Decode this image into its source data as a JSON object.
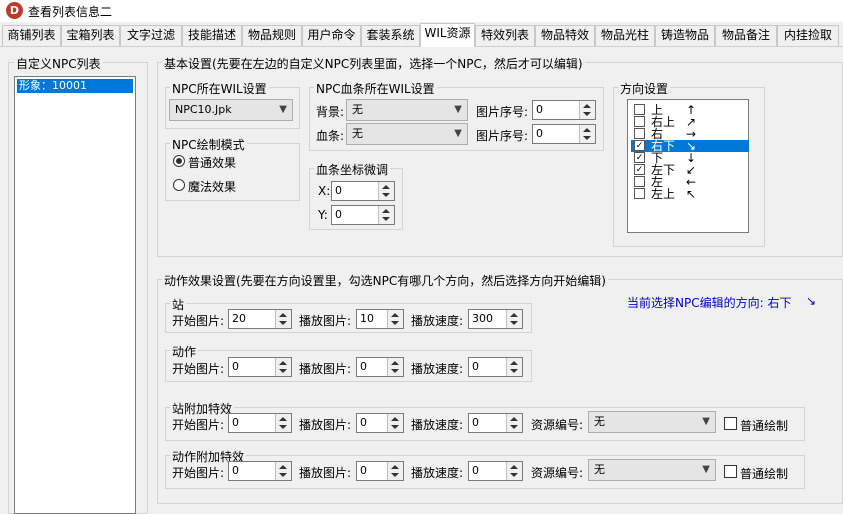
{
  "window": {
    "title": "查看列表信息二",
    "icon_letter": "D"
  },
  "tabs": [
    {
      "label": "商铺列表"
    },
    {
      "label": "宝箱列表"
    },
    {
      "label": "文字过滤"
    },
    {
      "label": "技能描述"
    },
    {
      "label": "物品规则"
    },
    {
      "label": "用户命令"
    },
    {
      "label": "套装系统"
    },
    {
      "label": "WIL资源"
    },
    {
      "label": "特效列表"
    },
    {
      "label": "物品特效"
    },
    {
      "label": "物品光柱"
    },
    {
      "label": "铸造物品"
    },
    {
      "label": "物品备注"
    },
    {
      "label": "内挂捡取"
    }
  ],
  "active_tab": "WIL资源",
  "npc_list": {
    "title": "自定义NPC列表",
    "items": [
      "形象：10001"
    ],
    "selected": "形象：10001"
  },
  "basic": {
    "title": "基本设置(先要在左边的自定义NPC列表里面，选择一个NPC，然后才可以编辑)",
    "npc_wil": {
      "title": "NPC所在WIL设置",
      "value": "NPC10.Jpk"
    },
    "draw_mode": {
      "title": "NPC绘制模式",
      "options": [
        "普通效果",
        "魔法效果"
      ],
      "selected": "普通效果"
    },
    "blood_wil": {
      "title": "NPC血条所在WIL设置",
      "bg_label": "背景:",
      "bg_value": "无",
      "bar_label": "血条:",
      "bar_value": "无",
      "img_label": "图片序号:",
      "img1": "0",
      "img2": "0"
    },
    "blood_offset": {
      "title": "血条坐标微调",
      "x_label": "X:",
      "x": "0",
      "y_label": "Y:",
      "y": "0"
    },
    "direction": {
      "title": "方向设置",
      "items": [
        {
          "name": "上",
          "arrow": "↑",
          "checked": false
        },
        {
          "name": "右上",
          "arrow": "↗",
          "checked": false
        },
        {
          "name": "右",
          "arrow": "→",
          "checked": false
        },
        {
          "name": "右下",
          "arrow": "↘",
          "checked": true
        },
        {
          "name": "下",
          "arrow": "↓",
          "checked": true
        },
        {
          "name": "左下",
          "arrow": "↙",
          "checked": true
        },
        {
          "name": "左",
          "arrow": "←",
          "checked": false
        },
        {
          "name": "左上",
          "arrow": "↖",
          "checked": false
        }
      ],
      "selected": "右下",
      "check_mark": "✓"
    }
  },
  "action": {
    "title": "动作效果设置(先要在方向设置里，勾选NPC有哪几个方向，然后选择方向开始编辑)",
    "current_dir_label": "当前选择NPC编辑的方向: 右下",
    "current_dir_arrow": "↘",
    "labels": {
      "start": "开始图片:",
      "play": "播放图片:",
      "speed": "播放速度:",
      "res": "资源编号:",
      "normal_draw": "普通绘制"
    },
    "stand": {
      "title": "站",
      "start": "20",
      "play": "10",
      "speed": "300"
    },
    "act": {
      "title": "动作",
      "start": "0",
      "play": "0",
      "speed": "0"
    },
    "stand_fx": {
      "title": "站附加特效",
      "start": "0",
      "play": "0",
      "speed": "0",
      "res": "无",
      "normal_draw": false
    },
    "act_fx": {
      "title": "动作附加特效",
      "start": "0",
      "play": "0",
      "speed": "0",
      "res": "无",
      "normal_draw": false
    }
  },
  "colors": {
    "accent": "#0078d7",
    "link_blue": "#0000cc",
    "icon_red": "#c0392b"
  }
}
